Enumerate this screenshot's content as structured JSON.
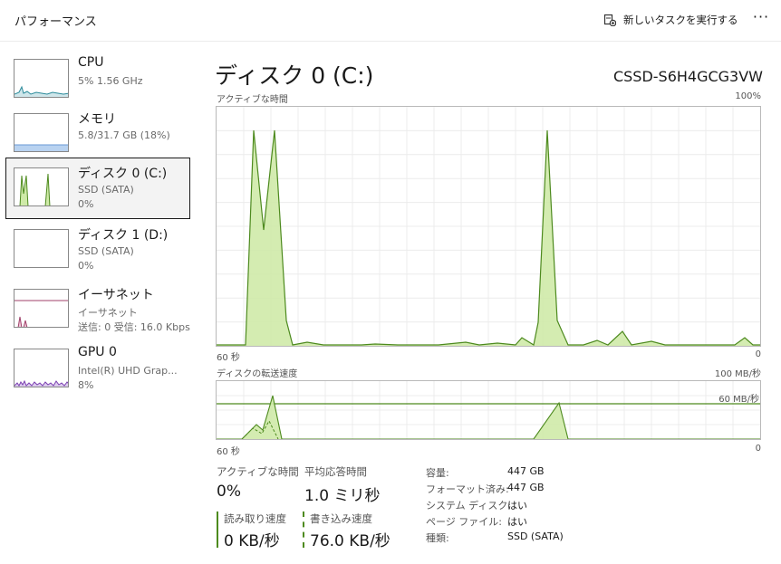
{
  "header": {
    "title": "パフォーマンス",
    "run_task_label": "新しいタスクを実行する",
    "more_label": "···"
  },
  "sidebar": {
    "items": [
      {
        "name": "CPU",
        "line1": "5%  1.56 GHz",
        "line2": ""
      },
      {
        "name": "メモリ",
        "line1": "5.8/31.7 GB (18%)",
        "line2": ""
      },
      {
        "name": "ディスク 0 (C:)",
        "line1": "SSD (SATA)",
        "line2": "0%"
      },
      {
        "name": "ディスク 1 (D:)",
        "line1": "SSD (SATA)",
        "line2": "0%"
      },
      {
        "name": "イーサネット",
        "line1": "イーサネット",
        "line2": "送信: 0 受信: 16.0 Kbps"
      },
      {
        "name": "GPU 0",
        "line1": "Intel(R) UHD Grap...",
        "line2": "8%"
      }
    ],
    "selected_index": 2
  },
  "main": {
    "title": "ディスク 0 (C:)",
    "model": "CSSD-S6H4GCG3VW",
    "active_graph": {
      "label": "アクティブな時間",
      "max_label": "100%",
      "time_left": "60 秒",
      "time_right": "0"
    },
    "transfer_graph": {
      "label": "ディスクの転送速度",
      "max_label": "100 MB/秒",
      "line_label": "60 MB/秒",
      "time_left": "60 秒",
      "time_right": "0"
    },
    "stats": {
      "active_time_label": "アクティブな時間",
      "active_time_value": "0%",
      "response_label": "平均応答時間",
      "response_value": "1.0 ミリ秒",
      "read_label": "読み取り速度",
      "read_value": "0 KB/秒",
      "write_label": "書き込み速度",
      "write_value": "76.0 KB/秒"
    },
    "info": [
      {
        "key": "容量:",
        "value": "447 GB"
      },
      {
        "key": "フォーマット済み:",
        "value": "447 GB"
      },
      {
        "key": "システム ディスク:",
        "value": "はい"
      },
      {
        "key": "ページ ファイル:",
        "value": "はい"
      },
      {
        "key": "種類:",
        "value": "SSD (SATA)"
      }
    ]
  },
  "colors": {
    "disk_line": "#4d8a1e",
    "disk_fill": "#cfeaa8",
    "cpu_line": "#2a8a9a",
    "memory_line": "#6a9ad6",
    "ethernet_line": "#a0406a",
    "gpu_line": "#7a3fb0"
  }
}
